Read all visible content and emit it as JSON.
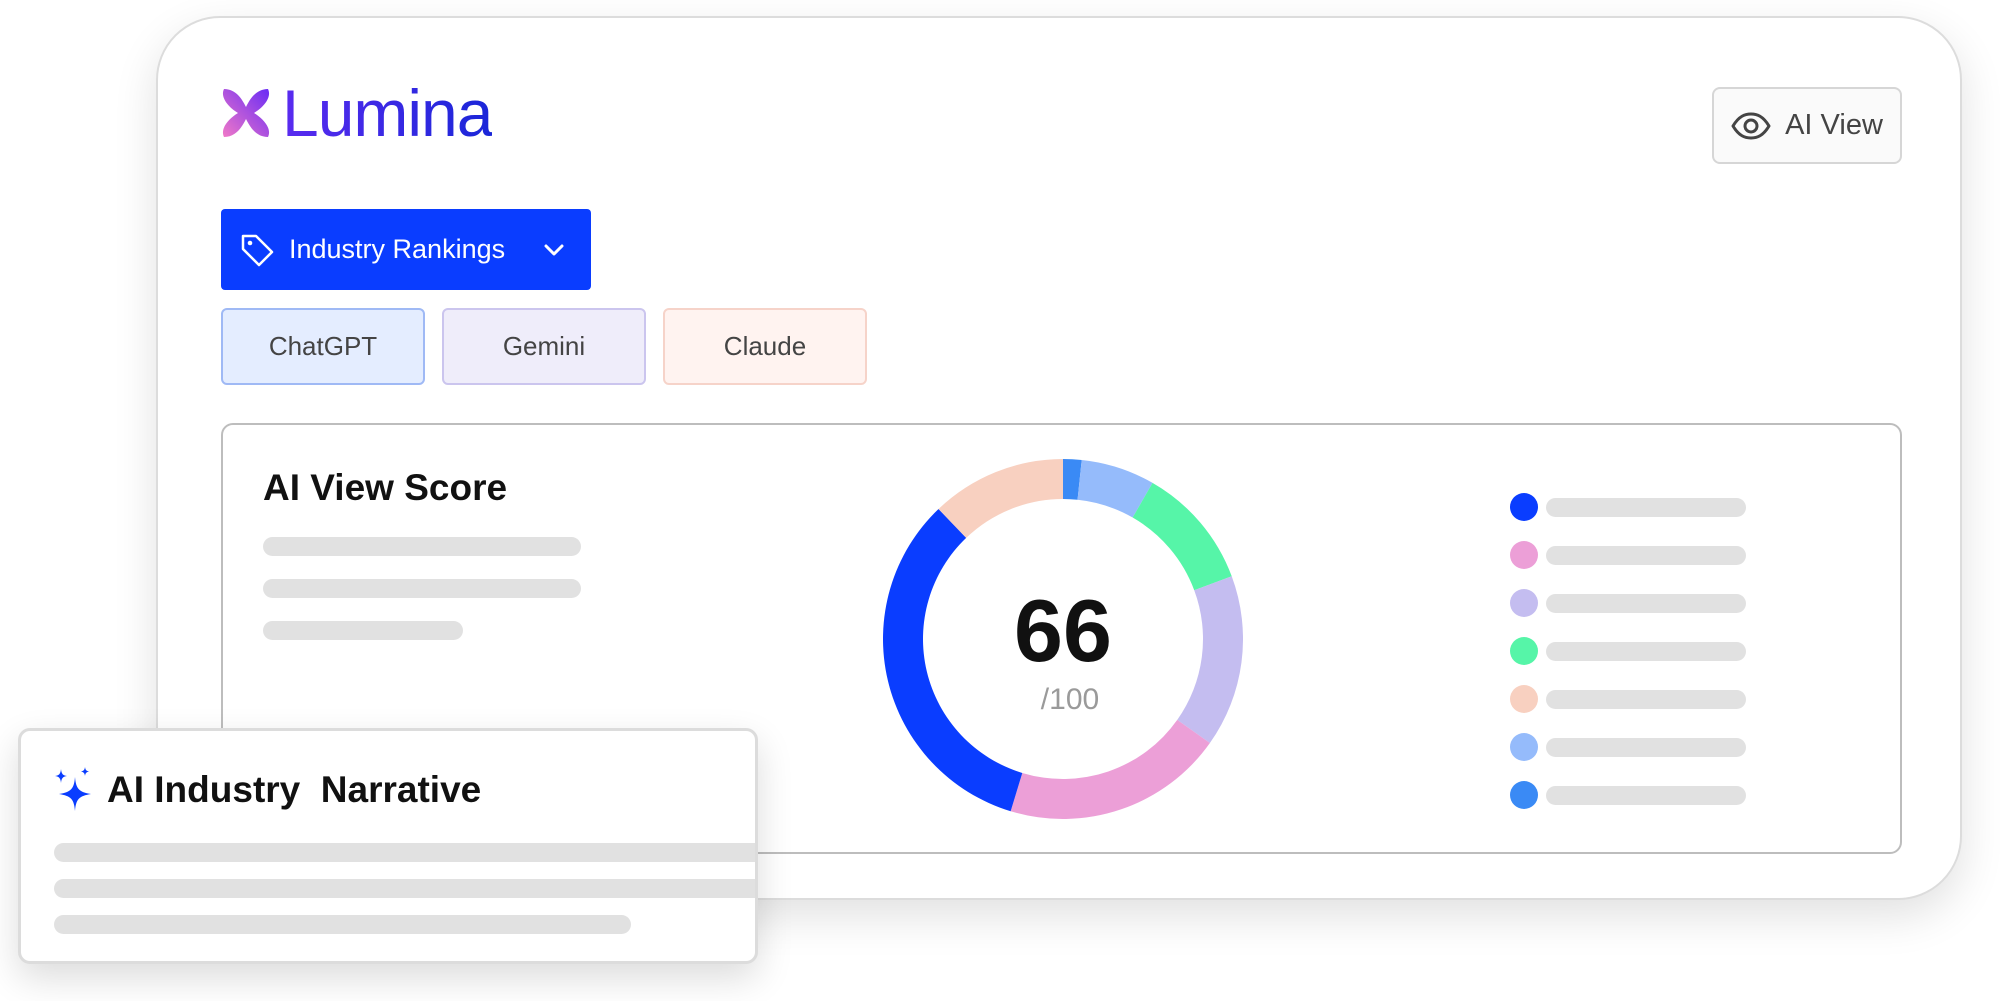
{
  "brand": {
    "name": "Lumina",
    "gradient_start": "#f078c8",
    "gradient_end": "#6a2cf5",
    "text_color": "#3b1fe0"
  },
  "header": {
    "ai_view_label": "AI View",
    "ai_view_icon": "eye-icon"
  },
  "filter": {
    "dropdown_label": "Industry Rankings",
    "dropdown_icon": "tag-icon",
    "accent": "#0a3dff"
  },
  "model_tabs": [
    {
      "label": "ChatGPT",
      "color": "#e4edff"
    },
    {
      "label": "Gemini",
      "color": "#efedfa"
    },
    {
      "label": "Claude",
      "color": "#fff3f0"
    }
  ],
  "score_panel": {
    "title": "AI View Score",
    "score": "66",
    "max": "/100"
  },
  "chart_data": {
    "type": "pie",
    "values": [
      1.5,
      6,
      10,
      14,
      18,
      30,
      11
    ],
    "colors": [
      "#3a8af5",
      "#95bbfb",
      "#56f5a8",
      "#c4bdf0",
      "#ec9fd7",
      "#0a3dff",
      "#f8d0c0"
    ],
    "legend_colors": [
      "#0a3dff",
      "#ec9fd7",
      "#c4bdf0",
      "#56f5a8",
      "#f8d0c0",
      "#95bbfb",
      "#3a8af5"
    ]
  },
  "narrative": {
    "title": "AI Industry  Narrative",
    "icon": "sparkles-icon"
  }
}
